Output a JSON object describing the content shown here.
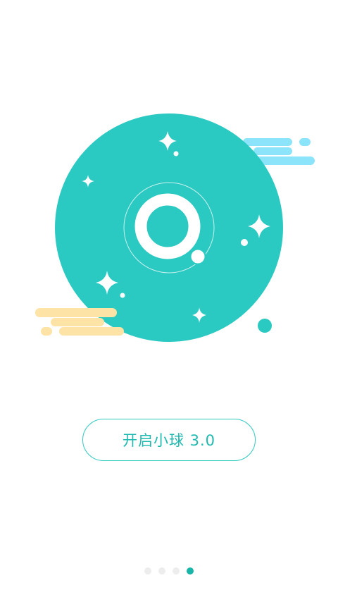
{
  "colors": {
    "primary": "#2ac9c1",
    "primary_dark": "#18b6a8",
    "cloud_blue": "#8ce4fa",
    "cloud_yellow": "#fde3a6",
    "background": "#ffffff",
    "inactive_dot": "#ededed"
  },
  "illustration": {
    "icon": "ball-logo-icon",
    "decorations": [
      "sparkle-icon",
      "cloud-icon",
      "dot-icon"
    ]
  },
  "start_button": {
    "label": "开启小球 3.0"
  },
  "pager": {
    "total_pages": 4,
    "current_page": 4
  }
}
